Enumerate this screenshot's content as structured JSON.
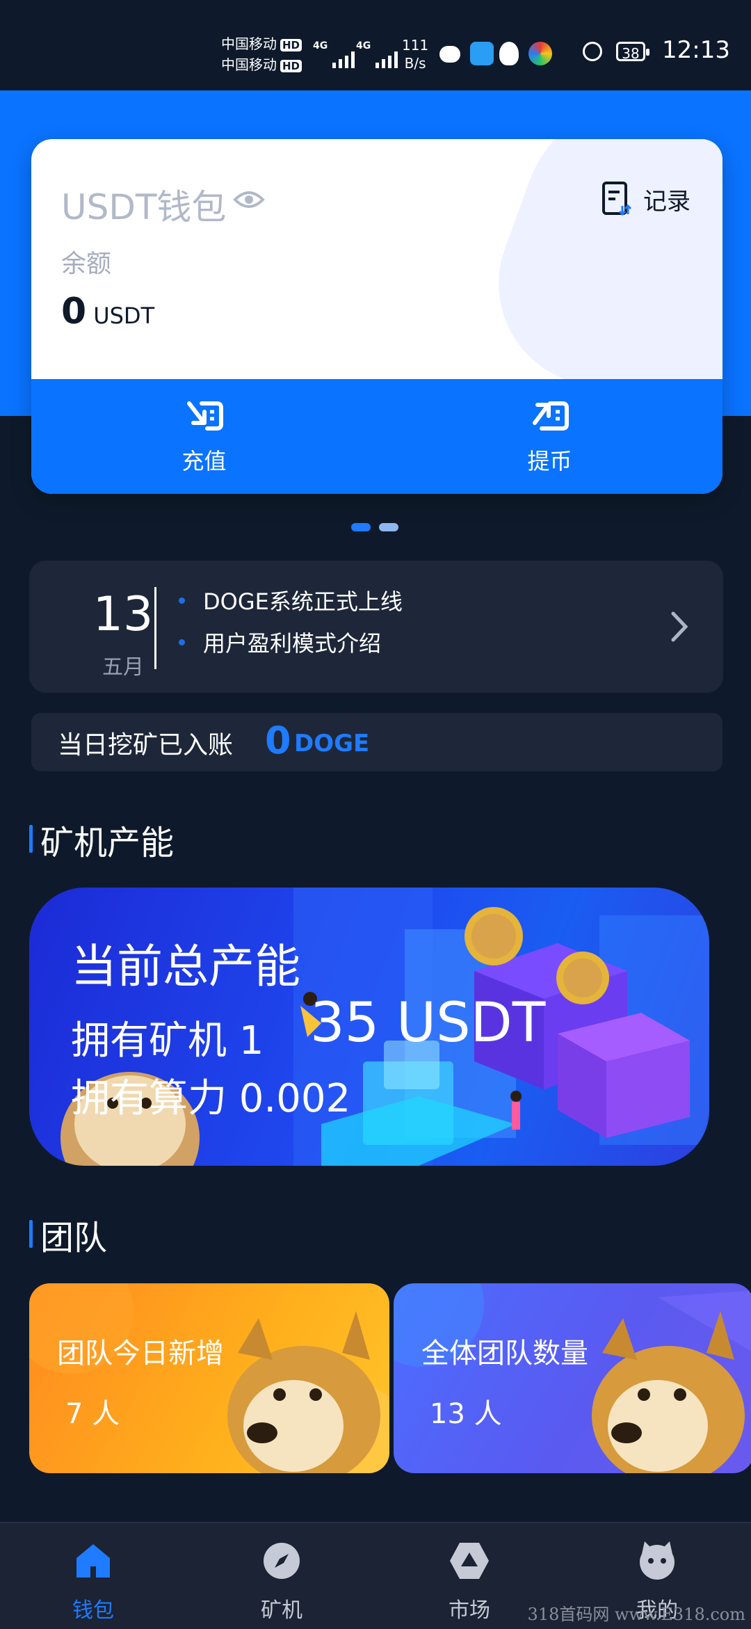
{
  "status_bar": {
    "carrier1": "中国移动",
    "carrier2": "中国移动",
    "hd": "HD",
    "network": "4G",
    "net_speed_value": "111",
    "net_speed_unit": "B/s",
    "battery": "38",
    "time": "12:13"
  },
  "wallet": {
    "title": "USDT钱包",
    "record_label": "记录",
    "balance_label": "余额",
    "balance_value": "0",
    "balance_unit": "USDT",
    "actions": [
      {
        "label": "充值",
        "icon": "deposit-icon"
      },
      {
        "label": "提币",
        "icon": "withdraw-icon"
      }
    ],
    "colors": {
      "accent": "#0a73ff",
      "text": "#0e1a2b",
      "muted": "#b0b8c9"
    }
  },
  "carousel": {
    "total": 2,
    "active": 0
  },
  "news": {
    "day": "13",
    "month": "五月",
    "items": [
      "DOGE系统正式上线",
      "用户盈利模式介绍"
    ]
  },
  "mined_today": {
    "label": "当日挖矿已入账",
    "value": "0",
    "unit": "DOGE"
  },
  "capacity": {
    "section_title": "矿机产能",
    "banner_title": "当前总产能",
    "machines": "拥有矿机 1",
    "hashrate": "拥有算力 0.002",
    "amount": "35 USDT"
  },
  "team": {
    "section_title": "团队",
    "cards": [
      {
        "title": "团队今日新增",
        "value": "7 人"
      },
      {
        "title": "全体团队数量",
        "value": "13 人"
      }
    ]
  },
  "nav": {
    "items": [
      {
        "label": "钱包",
        "icon": "wallet-home-icon",
        "active": true
      },
      {
        "label": "矿机",
        "icon": "compass-icon",
        "active": false
      },
      {
        "label": "市场",
        "icon": "market-icon",
        "active": false
      },
      {
        "label": "我的",
        "icon": "profile-icon",
        "active": false
      }
    ]
  },
  "watermark": "318首码网 www.E318.com"
}
